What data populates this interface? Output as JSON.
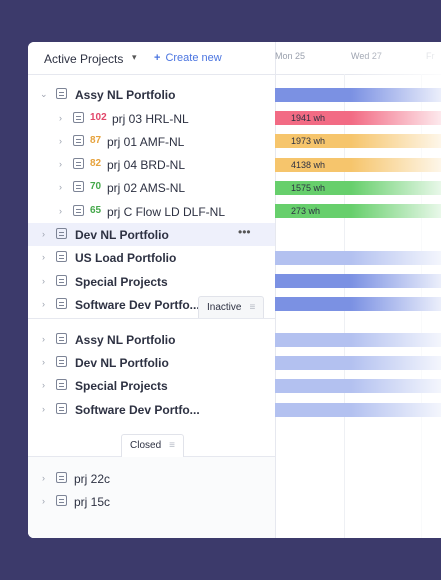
{
  "toolbar": {
    "title": "Active Projects",
    "create_label": "Create new"
  },
  "timeline": {
    "days": [
      "Mon 25",
      "Wed 27",
      "Fr"
    ]
  },
  "active": [
    {
      "label": "Assy NL Portfolio",
      "bold": true,
      "expanded": true
    },
    {
      "num": "102",
      "num_color": "#e2466a",
      "label": "prj 03 HRL-NL",
      "bar": "1941 wh",
      "bar_color": "#f26b84"
    },
    {
      "num": "87",
      "num_color": "#e6a23c",
      "label": "prj 01 AMF-NL",
      "bar": "1973 wh",
      "bar_color": "#f6c56c"
    },
    {
      "num": "82",
      "num_color": "#e6a23c",
      "label": "prj 04 BRD-NL",
      "bar": "4138 wh",
      "bar_color": "#f6c56c"
    },
    {
      "num": "70",
      "num_color": "#44a84a",
      "label": "prj 02 AMS-NL",
      "bar": "1575 wh",
      "bar_color": "#67cf6c"
    },
    {
      "num": "65",
      "num_color": "#44a84a",
      "label": "prj C Flow LD DLF-NL",
      "bar": "273 wh",
      "bar_color": "#67cf6c"
    },
    {
      "label": "Dev NL Portfolio",
      "bold": true,
      "highlighted": true
    },
    {
      "label": "US Load Portfolio",
      "bold": true
    },
    {
      "label": "Special Projects",
      "bold": true
    },
    {
      "label": "Software Dev Portfo...",
      "bold": true
    }
  ],
  "inactive_tab": "Inactive",
  "inactive": [
    {
      "label": "Assy NL Portfolio"
    },
    {
      "label": "Dev NL Portfolio"
    },
    {
      "label": "Special Projects"
    },
    {
      "label": "Software Dev Portfo..."
    }
  ],
  "closed_tab": "Closed",
  "closed": [
    {
      "label": "prj 22c"
    },
    {
      "label": "prj 15c"
    }
  ],
  "colors": {
    "bar_blue": "#7b91e3",
    "bar_blue_light": "#b3c1f0"
  }
}
